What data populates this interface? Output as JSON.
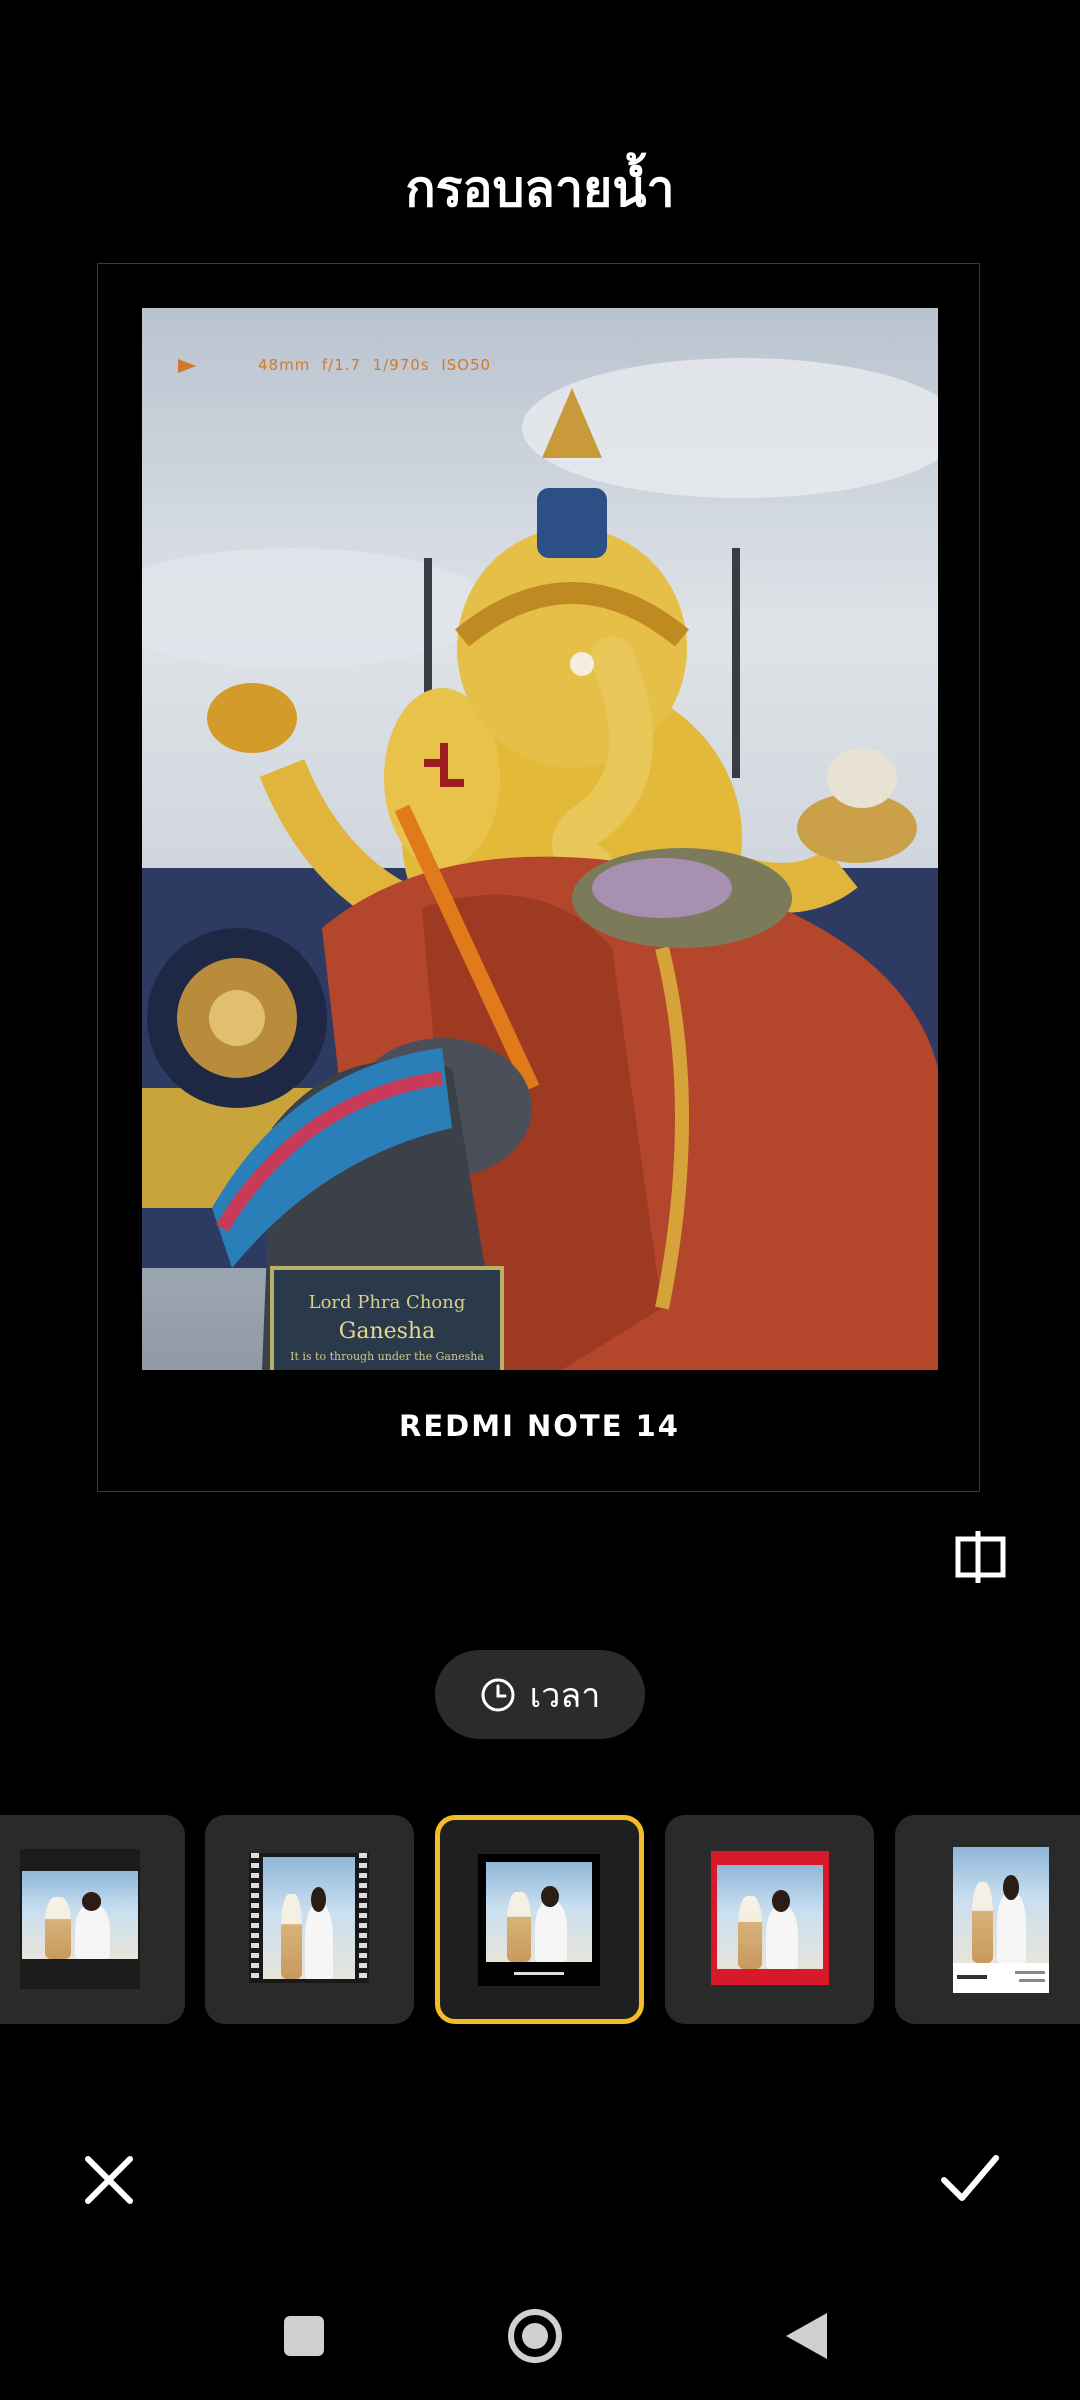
{
  "header": {
    "title": "กรอบลายน้ำ"
  },
  "preview": {
    "exif": {
      "focal": "48mm",
      "aperture": "f/1.7",
      "shutter": "1/970s",
      "iso": "ISO50"
    },
    "plaque": {
      "line1": "Lord Phra Chong",
      "line2": "Ganesha",
      "line3": "It is to through under the Ganesha"
    },
    "device_model": "REDMI NOTE 14"
  },
  "time_button": {
    "label": "เวลา",
    "icon": "clock-icon"
  },
  "thumbnails": [
    {
      "name": "filmstrip-dark-frame",
      "selected": false
    },
    {
      "name": "film-negative-frame",
      "selected": false
    },
    {
      "name": "black-border-frame",
      "selected": true
    },
    {
      "name": "red-border-frame",
      "selected": false
    },
    {
      "name": "white-polaroid-frame",
      "selected": false
    }
  ],
  "actions": {
    "cancel_icon": "close-icon",
    "confirm_icon": "checkmark-icon"
  },
  "colors": {
    "accent": "#f5bd25",
    "background": "#000000",
    "button_bg": "#2b2b2b"
  }
}
